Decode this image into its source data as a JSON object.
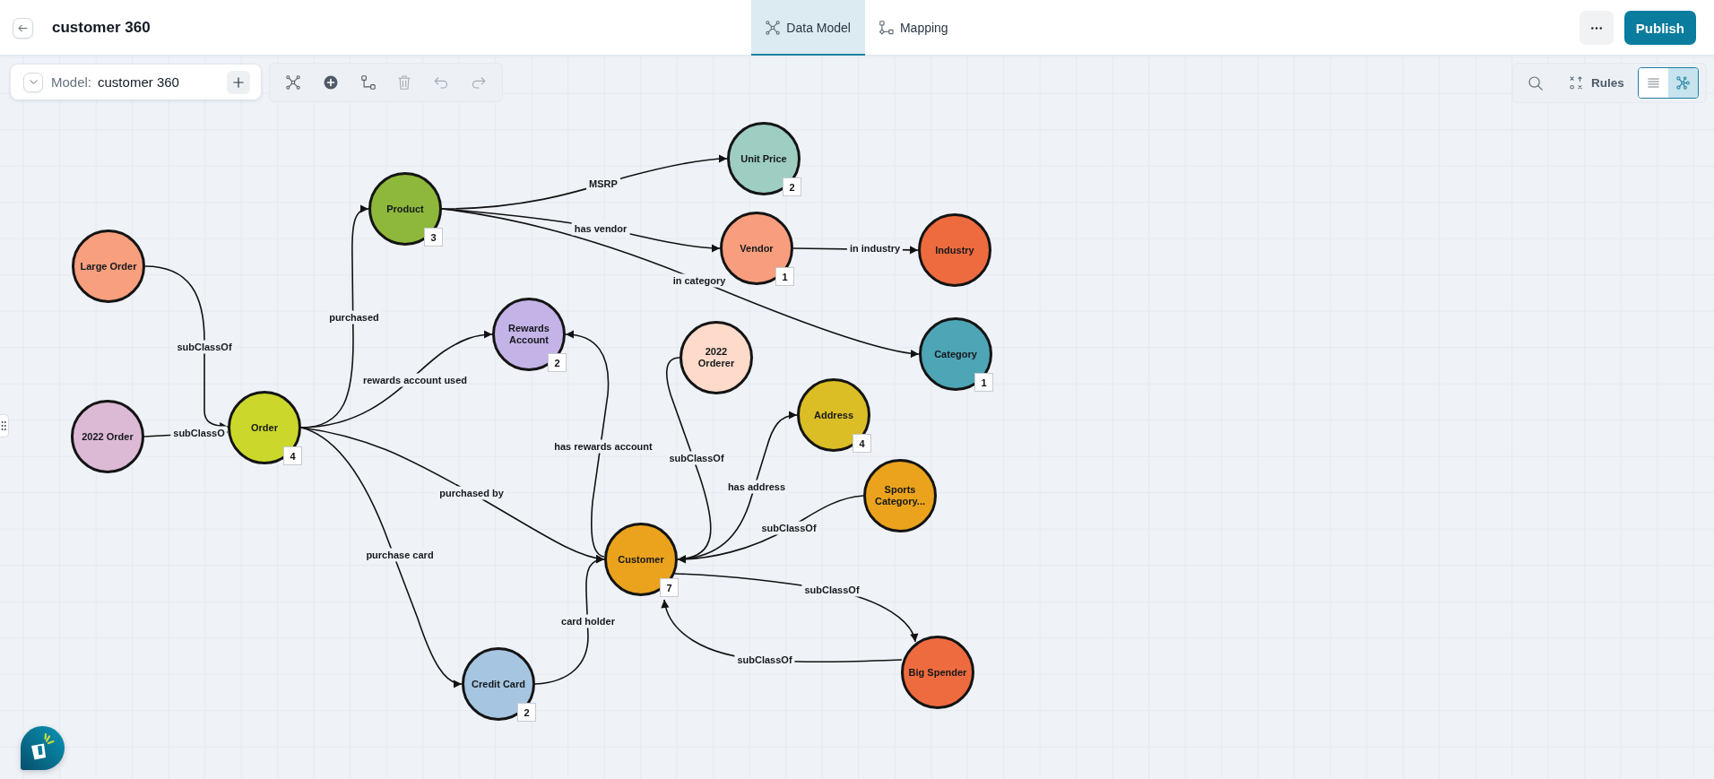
{
  "header": {
    "title": "customer 360",
    "tabs": [
      {
        "label": "Data Model",
        "selected": true
      },
      {
        "label": "Mapping",
        "selected": false
      }
    ],
    "publish": "Publish"
  },
  "model": {
    "label": "Model:",
    "name": "customer 360"
  },
  "tools": [
    {
      "kind": "network",
      "disabled": false
    },
    {
      "kind": "add",
      "disabled": false
    },
    {
      "kind": "connect",
      "disabled": false
    },
    {
      "kind": "delete",
      "disabled": true
    },
    {
      "kind": "undo",
      "disabled": true
    },
    {
      "kind": "redo",
      "disabled": true
    }
  ],
  "view": {
    "rules": "Rules",
    "modes": [
      {
        "kind": "list",
        "selected": false
      },
      {
        "kind": "graph",
        "selected": true
      }
    ]
  },
  "graph": {
    "nodes": [
      {
        "label": "Unit Price",
        "color": "#9ecdc2",
        "count": "2"
      },
      {
        "label": "Product",
        "color": "#8db83b",
        "count": "3"
      },
      {
        "label": "Large Order",
        "color": "#f89f7e"
      },
      {
        "label": "Vendor",
        "color": "#f89e7e",
        "count": "1"
      },
      {
        "label": "Industry",
        "color": "#ee6b3f"
      },
      {
        "label": "Rewards Account",
        "color": "#c3b3e6",
        "count": "2"
      },
      {
        "label": "2022 Orderer",
        "color": "#fddac9"
      },
      {
        "label": "Category",
        "color": "#4ea5b6",
        "count": "1"
      },
      {
        "label": "2022 Order",
        "color": "#dcbad6"
      },
      {
        "label": "Order",
        "color": "#cbd82b",
        "count": "4"
      },
      {
        "label": "Address",
        "color": "#dbbd25",
        "count": "4"
      },
      {
        "label": "Sports Category...",
        "color": "#eba31d"
      },
      {
        "label": "Customer",
        "color": "#eba31d",
        "count": "7"
      },
      {
        "label": "Credit Card",
        "color": "#a6c5e0",
        "count": "2"
      },
      {
        "label": "Big Spender",
        "color": "#ee6b3f"
      }
    ],
    "edges": [
      {
        "label": "MSRP"
      },
      {
        "label": "has vendor"
      },
      {
        "label": "in industry"
      },
      {
        "label": "in category"
      },
      {
        "label": "purchased"
      },
      {
        "label": "subClassOf"
      },
      {
        "label": "rewards account used"
      },
      {
        "label": "subClassOf"
      },
      {
        "label": "subClassO"
      },
      {
        "label": "has address"
      },
      {
        "label": "has rewards account"
      },
      {
        "label": "purchased by"
      },
      {
        "label": "subClassOf"
      },
      {
        "label": "purchase card"
      },
      {
        "label": "subClassOf"
      },
      {
        "label": "card holder"
      },
      {
        "label": "subClassOf"
      }
    ]
  }
}
